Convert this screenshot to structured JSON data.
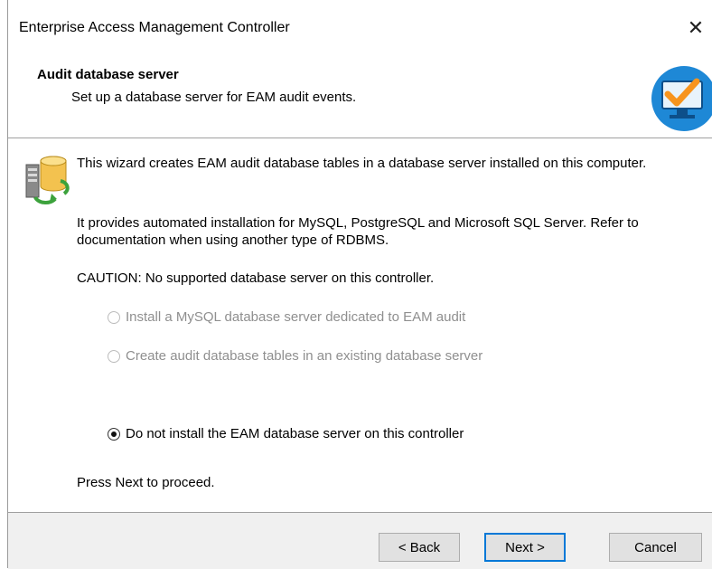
{
  "window": {
    "title": "Enterprise Access Management Controller",
    "close_glyph": "✕"
  },
  "header": {
    "title": "Audit database server",
    "subtitle": "Set up a database server for EAM audit events.",
    "icon": "monitor-checkmark-icon"
  },
  "body": {
    "icon": "database-server-icon",
    "intro": "This wizard creates EAM audit database tables in a database server installed on this computer.",
    "automation_note": "It provides automated installation for MySQL, PostgreSQL and Microsoft SQL Server. Refer to documentation when using another type of RDBMS.",
    "caution": "CAUTION: No supported database server on this controller.",
    "options": [
      {
        "label": "Install a MySQL database server dedicated to EAM audit",
        "selected": false,
        "enabled": false
      },
      {
        "label": "Create audit database tables in an existing database server",
        "selected": false,
        "enabled": false
      },
      {
        "label": "Do not install the EAM database server on this controller",
        "selected": true,
        "enabled": true
      }
    ],
    "proceed_note": "Press Next to proceed."
  },
  "footer": {
    "back_label": "< Back",
    "next_label": "Next >",
    "cancel_label": "Cancel"
  },
  "colors": {
    "accent": "#0078d7",
    "header_icon_blue": "#1e88d6",
    "check_orange": "#f7941d"
  }
}
